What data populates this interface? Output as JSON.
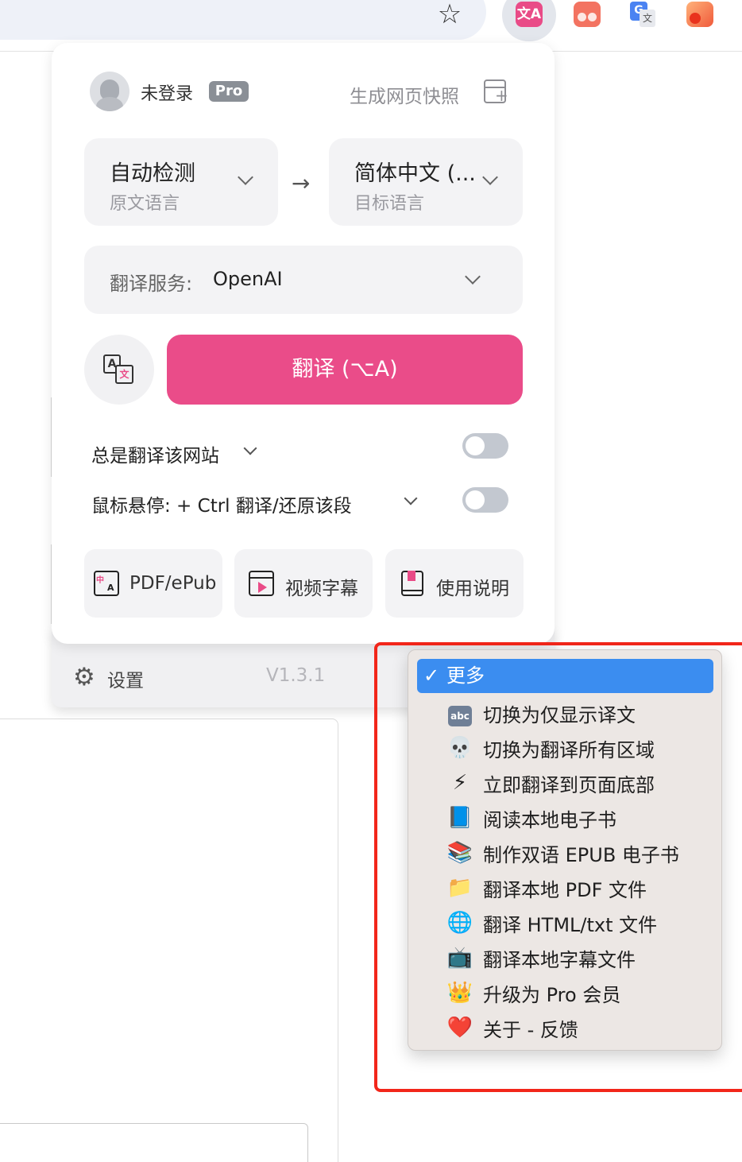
{
  "browser": {
    "ext_imt_icon": "文A"
  },
  "popup": {
    "user": {
      "login_status": "未登录",
      "badge": "Pro"
    },
    "snapshot_label": "生成网页快照",
    "source_lang": {
      "value": "自动检测",
      "caption": "原文语言"
    },
    "target_lang": {
      "value": "简体中文 (...",
      "caption": "目标语言"
    },
    "service": {
      "label": "翻译服务:",
      "value": "OpenAI"
    },
    "translate_button": "翻译 (⌥A)",
    "rows": [
      {
        "label": "总是翻译该网站",
        "enabled": false
      },
      {
        "label": "鼠标悬停:  + Ctrl 翻译/还原该段",
        "enabled": false
      }
    ],
    "tools": [
      {
        "label": "PDF/ePub"
      },
      {
        "label": "视频字幕"
      },
      {
        "label": "使用说明"
      }
    ],
    "footer": {
      "settings_label": "设置",
      "version": "V1.3.1"
    }
  },
  "menu": {
    "selected": "更多",
    "items": [
      {
        "icon": "abc",
        "label": "切换为仅显示译文"
      },
      {
        "icon": "💀",
        "label": "切换为翻译所有区域"
      },
      {
        "icon": "⚡",
        "label": "立即翻译到页面底部"
      },
      {
        "icon": "📘",
        "label": "阅读本地电子书"
      },
      {
        "icon": "📚",
        "label": "制作双语 EPUB 电子书"
      },
      {
        "icon": "📁",
        "label": "翻译本地 PDF 文件"
      },
      {
        "icon": "🌐",
        "label": "翻译 HTML/txt 文件"
      },
      {
        "icon": "📺",
        "label": "翻译本地字幕文件"
      },
      {
        "icon": "👑",
        "label": "升级为 Pro 会员"
      },
      {
        "icon": "❤️",
        "label": "关于 - 反馈"
      }
    ]
  },
  "colors": {
    "accent": "#ea4c89",
    "highlight_frame": "#f2261a",
    "menu_selected": "#3b8df0"
  }
}
